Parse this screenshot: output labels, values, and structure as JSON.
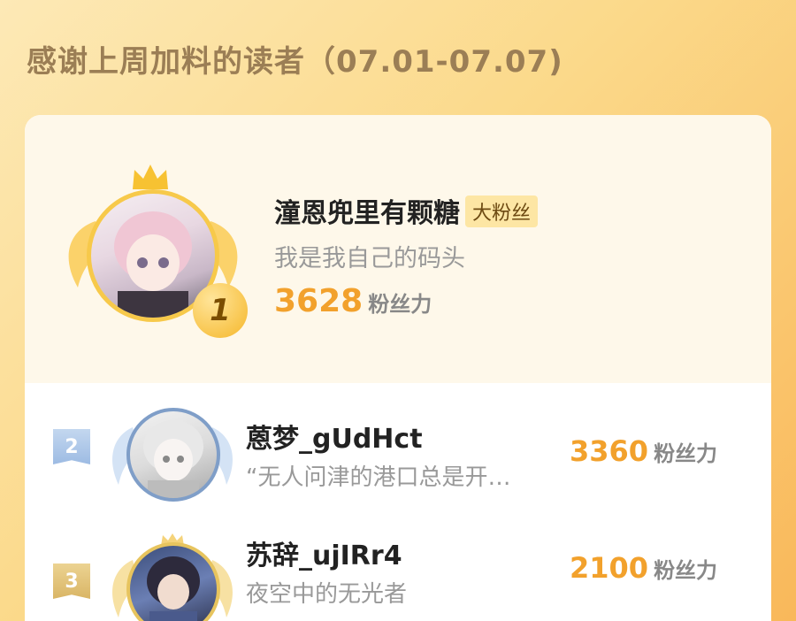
{
  "header": {
    "title": "感谢上周加料的读者（07.01-07.07)"
  },
  "ranking": [
    {
      "rank": "1",
      "name": "潼恩兜里有颗糖",
      "badge": "大粉丝",
      "motto": "我是我自己的码头",
      "score": "3628",
      "unit": "粉丝力"
    },
    {
      "rank": "2",
      "name": "蒽梦_gUdHct",
      "motto": "“无人问津的港口总是开…",
      "score": "3360",
      "unit": "粉丝力"
    },
    {
      "rank": "3",
      "name": "苏辞_ujIRr4",
      "motto": "夜空中的无光者",
      "score": "2100",
      "unit": "粉丝力"
    }
  ],
  "colors": {
    "gold": "#f2a12c",
    "title": "#9b7e55",
    "silver_flag": "#a9c4e6",
    "bronze_flag": "#e2c27a"
  }
}
